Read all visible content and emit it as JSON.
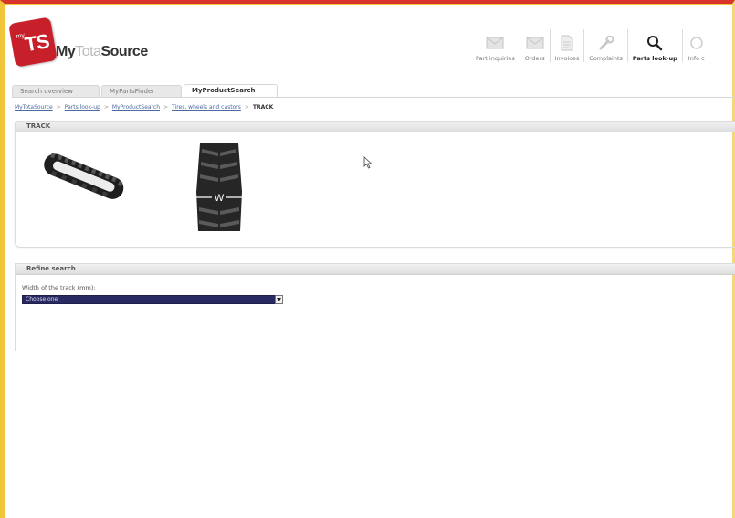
{
  "brand": {
    "badge_small": "my",
    "badge": "TS",
    "name_prefix": "My",
    "name_light": "Tota",
    "name_bold": "Source"
  },
  "topnav": [
    {
      "label": "Part inquiries",
      "icon": "envelope-icon",
      "active": false
    },
    {
      "label": "Orders",
      "icon": "envelope-icon",
      "active": false
    },
    {
      "label": "Invoices",
      "icon": "document-icon",
      "active": false
    },
    {
      "label": "Complaints",
      "icon": "wrench-icon",
      "active": false
    },
    {
      "label": "Parts look-up",
      "icon": "search-icon",
      "active": true
    },
    {
      "label": "Info c",
      "icon": "info-icon",
      "active": false
    }
  ],
  "tabs": [
    {
      "label": "Search overview",
      "active": false
    },
    {
      "label": "MyPartsFinder",
      "active": false
    },
    {
      "label": "MyProductSearch",
      "active": true
    }
  ],
  "breadcrumb": {
    "items": [
      "MyTotaSource",
      "Parts look-up",
      "MyProductSearch",
      "Tires, wheels and castors"
    ],
    "current": "TRACK"
  },
  "track_panel": {
    "title": "TRACK",
    "width_marker": "W"
  },
  "refine_panel": {
    "title": "Refine search",
    "field_label": "Width of the track (mm):",
    "select_value": "Choose one"
  },
  "colors": {
    "brand_red": "#c8202b",
    "select_bg": "#2a2a62"
  }
}
